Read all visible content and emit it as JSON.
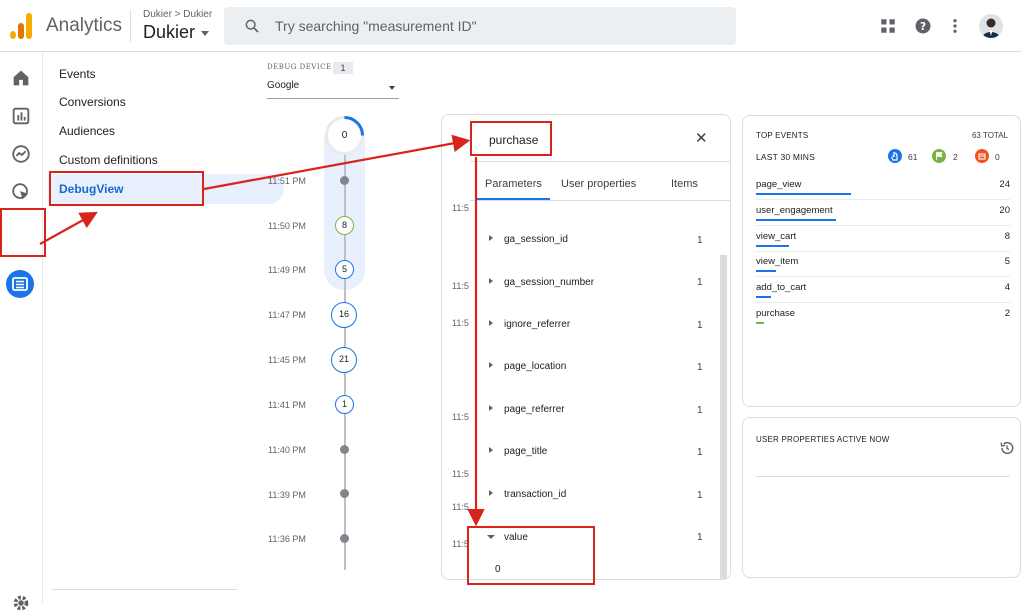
{
  "topbar": {
    "app_title": "Analytics",
    "account_crumb": "Dukier > Dukier",
    "property_name": "Dukier",
    "search_placeholder": "Try searching \"measurement ID\""
  },
  "subnav": {
    "items": [
      "Events",
      "Conversions",
      "Audiences",
      "Custom definitions"
    ],
    "active": "DebugView"
  },
  "debug_device": {
    "label": "DEBUG DEVICE",
    "count": "1",
    "selected": "Google"
  },
  "stream": {
    "top_count": "0",
    "entries": [
      {
        "time": "11:51 PM",
        "count": ""
      },
      {
        "time": "11:50 PM",
        "count": "8"
      },
      {
        "time": "11:49 PM",
        "count": "5"
      },
      {
        "time": "11:47 PM",
        "count": "16"
      },
      {
        "time": "11:45 PM",
        "count": "21"
      },
      {
        "time": "11:41 PM",
        "count": "1"
      },
      {
        "time": "11:40 PM",
        "count": ""
      },
      {
        "time": "11:39 PM",
        "count": ""
      },
      {
        "time": "11:36 PM",
        "count": ""
      }
    ]
  },
  "event_panel": {
    "title": "purchase",
    "tabs": [
      "Parameters",
      "User properties",
      "Items"
    ],
    "params": [
      {
        "name": "ga_session_id",
        "count": "1"
      },
      {
        "name": "ga_session_number",
        "count": "1"
      },
      {
        "name": "ignore_referrer",
        "count": "1"
      },
      {
        "name": "page_location",
        "count": "1"
      },
      {
        "name": "page_referrer",
        "count": "1"
      },
      {
        "name": "page_title",
        "count": "1"
      },
      {
        "name": "transaction_id",
        "count": "1"
      }
    ],
    "expanded_param": {
      "name": "value",
      "count": "1",
      "value": "0"
    },
    "left_stub": "11:5"
  },
  "top_events": {
    "title": "TOP EVENTS",
    "total": "63 TOTAL",
    "period": "LAST 30 MINS",
    "counters": {
      "blue": "61",
      "green": "2",
      "orange": "0"
    },
    "events": [
      {
        "name": "page_view",
        "count": "24",
        "share": 0.38
      },
      {
        "name": "user_engagement",
        "count": "20",
        "share": 0.32
      },
      {
        "name": "view_cart",
        "count": "8",
        "share": 0.13
      },
      {
        "name": "view_item",
        "count": "5",
        "share": 0.08
      },
      {
        "name": "add_to_cart",
        "count": "4",
        "share": 0.06
      },
      {
        "name": "purchase",
        "count": "2",
        "share": 0.03
      }
    ]
  },
  "user_properties": {
    "title": "USER PROPERTIES ACTIVE NOW"
  },
  "colors": {
    "accent": "#1a73e8",
    "annotation": "#d9241b",
    "green": "#7cb342",
    "orange": "#f4511e"
  }
}
